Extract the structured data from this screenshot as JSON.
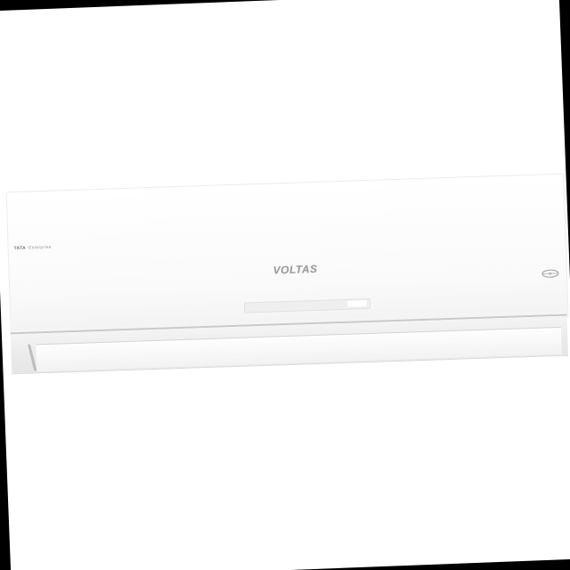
{
  "photo": {
    "subject": "Voltas split air conditioner indoor unit",
    "brand_logo": "VOLTAS",
    "corner_tag": {
      "strong": "TATA",
      "text": "Enterprise"
    },
    "icons": [
      "remote-sensor-icon"
    ],
    "colors": {
      "body": "#ffffff",
      "logo": "#9c9c9c",
      "background_border": "#000000"
    }
  }
}
